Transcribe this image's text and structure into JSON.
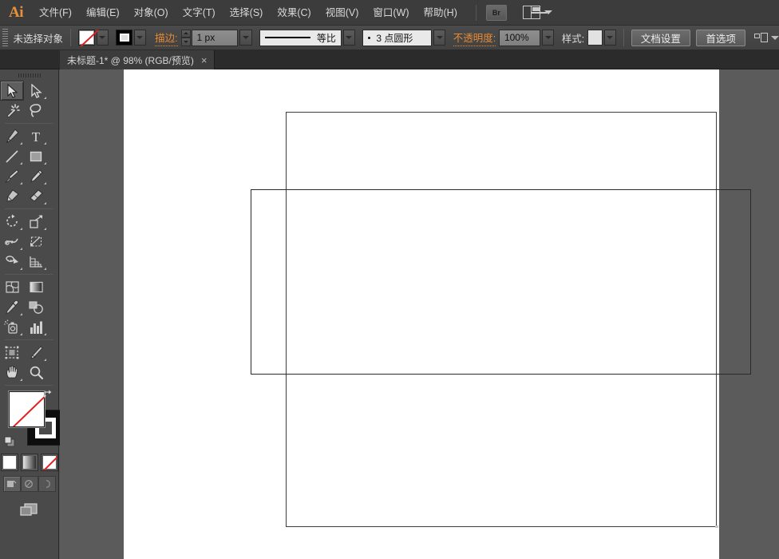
{
  "app": {
    "name": "Ai",
    "logo_text": "Ai"
  },
  "menubar": {
    "items": [
      {
        "label": "文件(F)",
        "name": "menu-file"
      },
      {
        "label": "编辑(E)",
        "name": "menu-edit"
      },
      {
        "label": "对象(O)",
        "name": "menu-object"
      },
      {
        "label": "文字(T)",
        "name": "menu-type"
      },
      {
        "label": "选择(S)",
        "name": "menu-select"
      },
      {
        "label": "效果(C)",
        "name": "menu-effect"
      },
      {
        "label": "视图(V)",
        "name": "menu-view"
      },
      {
        "label": "窗口(W)",
        "name": "menu-window"
      },
      {
        "label": "帮助(H)",
        "name": "menu-help"
      }
    ],
    "bridge_label": "Br",
    "arrange_icon": "arrange-documents-icon"
  },
  "controlbar": {
    "selection_status": "未选择对象",
    "fill_label": "fill-swatch",
    "fill_value": "无",
    "stroke_color_label": "stroke-swatch",
    "stroke_label": "描边:",
    "stroke_weight": "1 px",
    "profile_label": "等比",
    "brush_label": "3 点圆形",
    "opacity_label": "不透明度:",
    "opacity_value": "100%",
    "style_label": "样式:",
    "doc_setup_label": "文档设置",
    "preferences_label": "首选项",
    "align_icon": "align-objects-icon"
  },
  "tabbar": {
    "document_title": "未标题-1* @ 98% (RGB/预览)",
    "close_label": "×"
  },
  "toolbar": {
    "groups": [
      {
        "rows": [
          [
            {
              "name": "selection-tool",
              "icon": "arrow-solid-icon",
              "selected": true,
              "corner": false
            },
            {
              "name": "direct-selection-tool",
              "icon": "arrow-outline-icon",
              "selected": false,
              "corner": true
            }
          ],
          [
            {
              "name": "magic-wand-tool",
              "icon": "magic-wand-icon",
              "selected": false,
              "corner": false
            },
            {
              "name": "lasso-tool",
              "icon": "lasso-icon",
              "selected": false,
              "corner": false
            }
          ]
        ]
      },
      {
        "rows": [
          [
            {
              "name": "pen-tool",
              "icon": "pen-nib-icon",
              "selected": false,
              "corner": true
            },
            {
              "name": "type-tool",
              "icon": "type-T-icon",
              "selected": false,
              "corner": true
            }
          ],
          [
            {
              "name": "line-segment-tool",
              "icon": "line-diagonal-icon",
              "selected": false,
              "corner": true
            },
            {
              "name": "rectangle-tool",
              "icon": "rectangle-icon",
              "selected": false,
              "corner": true
            }
          ],
          [
            {
              "name": "paintbrush-tool",
              "icon": "paintbrush-icon",
              "selected": false,
              "corner": true
            },
            {
              "name": "pencil-tool",
              "icon": "pencil-icon",
              "selected": false,
              "corner": true
            }
          ],
          [
            {
              "name": "blob-brush-tool",
              "icon": "blob-brush-icon",
              "selected": false,
              "corner": false
            },
            {
              "name": "eraser-tool",
              "icon": "eraser-icon",
              "selected": false,
              "corner": true
            }
          ]
        ]
      },
      {
        "rows": [
          [
            {
              "name": "rotate-tool",
              "icon": "rotate-icon",
              "selected": false,
              "corner": true
            },
            {
              "name": "scale-tool",
              "icon": "scale-icon",
              "selected": false,
              "corner": true
            }
          ],
          [
            {
              "name": "width-tool",
              "icon": "width-warp-icon",
              "selected": false,
              "corner": true
            },
            {
              "name": "free-transform-tool",
              "icon": "free-transform-icon",
              "selected": false,
              "corner": false
            }
          ],
          [
            {
              "name": "shape-builder-tool",
              "icon": "shape-builder-icon",
              "selected": false,
              "corner": true
            },
            {
              "name": "perspective-grid-tool",
              "icon": "perspective-grid-icon",
              "selected": false,
              "corner": true
            }
          ]
        ]
      },
      {
        "rows": [
          [
            {
              "name": "mesh-tool",
              "icon": "mesh-icon",
              "selected": false,
              "corner": false
            },
            {
              "name": "gradient-tool",
              "icon": "gradient-icon",
              "selected": false,
              "corner": false
            }
          ],
          [
            {
              "name": "eyedropper-tool",
              "icon": "eyedropper-icon",
              "selected": false,
              "corner": true
            },
            {
              "name": "blend-tool",
              "icon": "blend-icon",
              "selected": false,
              "corner": false
            }
          ],
          [
            {
              "name": "symbol-sprayer-tool",
              "icon": "symbol-sprayer-icon",
              "selected": false,
              "corner": true
            },
            {
              "name": "column-graph-tool",
              "icon": "bar-graph-icon",
              "selected": false,
              "corner": true
            }
          ]
        ]
      },
      {
        "rows": [
          [
            {
              "name": "artboard-tool",
              "icon": "artboard-icon",
              "selected": false,
              "corner": false
            },
            {
              "name": "slice-tool",
              "icon": "slice-knife-icon",
              "selected": false,
              "corner": true
            }
          ],
          [
            {
              "name": "hand-tool",
              "icon": "hand-icon",
              "selected": false,
              "corner": true
            },
            {
              "name": "zoom-tool",
              "icon": "magnifier-icon",
              "selected": false,
              "corner": false
            }
          ]
        ]
      }
    ],
    "fill_stroke": {
      "fill_name": "fill-color-swatch",
      "fill_state": "none",
      "stroke_name": "stroke-color-swatch",
      "stroke_state": "black",
      "swap_name": "swap-fill-stroke-icon",
      "default_name": "default-fill-stroke-icon"
    },
    "color_modes": [
      {
        "name": "color-mode-button",
        "type": "color"
      },
      {
        "name": "gradient-mode-button",
        "type": "gradient"
      },
      {
        "name": "none-mode-button",
        "type": "none"
      }
    ],
    "draw_modes": [
      {
        "name": "draw-normal-button",
        "active": true
      },
      {
        "name": "draw-behind-button",
        "active": false
      },
      {
        "name": "draw-inside-button",
        "active": false
      }
    ],
    "screen_mode": {
      "name": "change-screen-mode-button"
    }
  },
  "canvas": {
    "zoom": "98%",
    "color_mode": "RGB",
    "view_mode": "预览",
    "objects": [
      {
        "name": "artboard-rectangle",
        "stroke": "#3d3d3d"
      },
      {
        "name": "drawn-rectangle",
        "stroke": "#2a2a2a"
      }
    ],
    "page_bg": "#ffffff",
    "work_area_bg": "#5b5b5b"
  },
  "colors": {
    "accent_orange": "#e88a34",
    "chrome_dark": "#3c3c3c",
    "chrome_mid": "#4a4a4a",
    "work_area": "#5b5b5b",
    "stroke_red": "#e32020"
  }
}
